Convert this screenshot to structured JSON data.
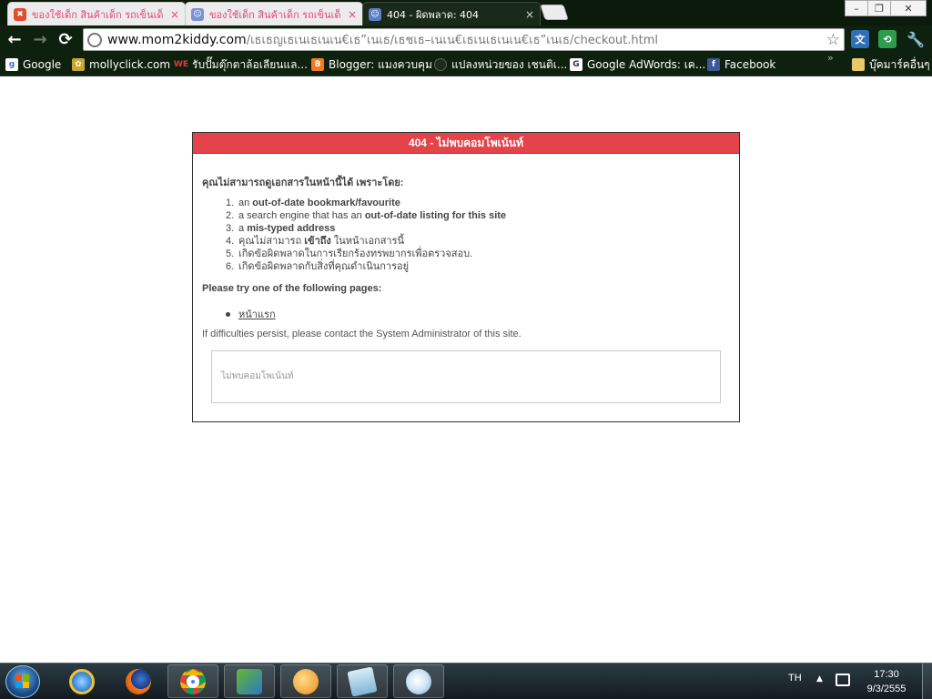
{
  "browser": {
    "tabs": [
      {
        "label": "ของใช้เด็ก สินค้าเด็ก รถเข็นเด็",
        "close": "×",
        "state": "inactive"
      },
      {
        "label": "ของใช้เด็ก สินค้าเด็ก รถเข็นเด็",
        "close": "×",
        "state": "inactive"
      },
      {
        "label": "404 - ผิดพลาด: 404",
        "close": "×",
        "state": "active"
      }
    ],
    "window_controls": {
      "minimize": "–",
      "restore": "❐",
      "close": "✕"
    },
    "nav": {
      "back": "←",
      "forward": "→",
      "reload": "⟳"
    },
    "url": {
      "host": "www.mom2kiddy.com",
      "path": "/เธเธญเธเนเธเนเน€เธ”เนเธ/เธชเธ–เนเน€เธเนเธเนเน€เธ”เนเธ/checkout.html"
    },
    "bookmarks": [
      {
        "label": "Google",
        "icon": "google-icon"
      },
      {
        "label": "mollyclick.com",
        "icon": "molly-icon"
      },
      {
        "label": "รับปั๊มตุ๊กตาล้อเลียนแล...",
        "icon": "we-icon"
      },
      {
        "label": "Blogger: แมงควบคุม",
        "icon": "blogger-icon"
      },
      {
        "label": "แปลงหน่วยของ เชนติเ...",
        "icon": "globe-icon"
      },
      {
        "label": "Google AdWords: เค...",
        "icon": "adwords-icon"
      },
      {
        "label": "Facebook",
        "icon": "facebook-icon"
      }
    ],
    "bookmarks_more": "»",
    "other_bookmarks": "บุ๊คมาร์คอื่นๆ"
  },
  "error": {
    "title": "404 - ไม่พบคอมโพเน้นท์",
    "reason_heading": "คุณไม่สามารถดูเอกสารในหน้านี้ได้ เพราะโดย:",
    "reasons": [
      {
        "n": "1.",
        "pre": "an ",
        "bold": "out-of-date bookmark/favourite",
        "post": ""
      },
      {
        "n": "2.",
        "pre": "a search engine that has an ",
        "bold": "out-of-date listing for this site",
        "post": ""
      },
      {
        "n": "3.",
        "pre": "a ",
        "bold": "mis-typed address",
        "post": ""
      },
      {
        "n": "4.",
        "pre": "คุณไม่สามารถ ",
        "bold": "เข้าถึง",
        "post": " ในหน้าเอกสารนี้"
      },
      {
        "n": "5.",
        "pre": "เกิดข้อผิดพลาดในการเรียกร้องทรพยากรเพื่อตรวจสอบ.",
        "bold": "",
        "post": ""
      },
      {
        "n": "6.",
        "pre": "เกิดข้อผิดพลาดกับสิ่งที่คุณดำเนินการอยู่",
        "bold": "",
        "post": ""
      }
    ],
    "try_heading": "Please try one of the following pages:",
    "pages": [
      {
        "label": "หน้าแรก"
      }
    ],
    "contact": "If difficulties persist, please contact the System Administrator of this site.",
    "message": "ไม่พบคอมโพเน้นท์"
  },
  "taskbar": {
    "language": "TH",
    "tray_arrow": "▲",
    "time": "17:30",
    "date": "9/3/2555"
  },
  "colors": {
    "error_header": "#e4434a",
    "chrome_dark": "#0e210e",
    "tab_inactive_text": "#e3487a"
  }
}
